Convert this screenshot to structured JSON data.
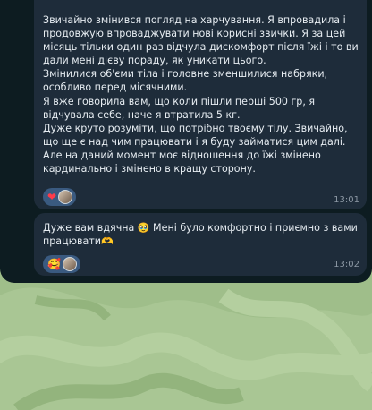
{
  "messages": [
    {
      "text": "Звичайно змінився погляд на харчування. Я впровадила і продовжую впроваджувати нові корисні звички. Я за цей місяць тільки один раз відчула дискомфорт після їжі і то ви дали мені дієву пораду, як уникати цього.\nЗмінилися об'єми тіла і головне зменшилися набряки, особливо перед місячними.\nЯ вже говорила вам, що коли пішли перші 500 гр, я відчувала себе, наче я втратила 5 кг.\nДуже круто розуміти, що потрібно твоєму тілу. Звичайно, що ще є над чим працювати і я буду займатися цим далі. Але на даний момент моє відношення до їжі змінено кардинально і змінено в кращу сторону.",
      "reaction_emoji": "❤",
      "time": "13:01"
    },
    {
      "text_part1": "Дуже вам вдячна ",
      "emoji1": "🥹",
      "text_part2": " Мені було комфортно і приємно з вами працювати",
      "emoji2": "🫶",
      "reaction_emoji": "🥰",
      "time": "13:02"
    }
  ],
  "colors": {
    "panel_bg": "#0d1c21",
    "bubble_bg": "#1e2c3a",
    "reaction_bg": "#3a5a80",
    "wallpaper": "#9fbe8a"
  }
}
